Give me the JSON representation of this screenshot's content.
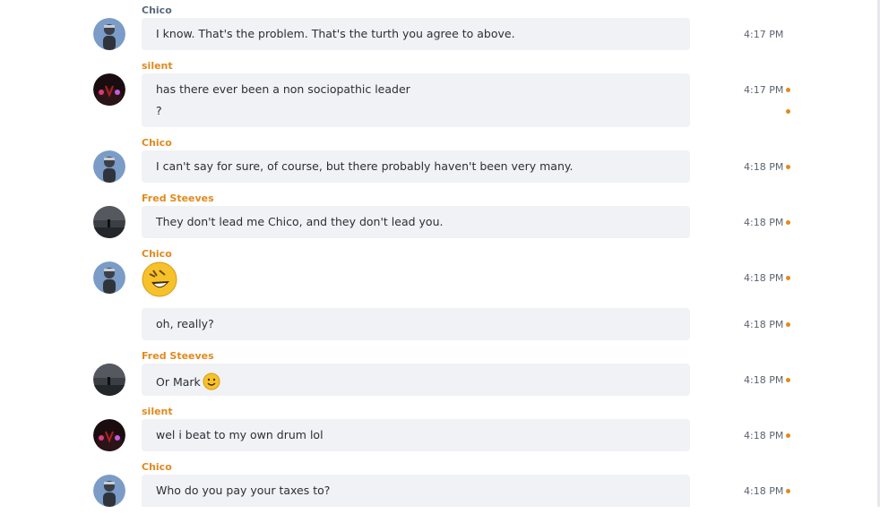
{
  "colors": {
    "author_name": "#e08a1e",
    "bubble": "#f0f2f6",
    "time": "#5b6470",
    "unread_dot": "#e08a1e"
  },
  "messages": [
    {
      "author": "Chico",
      "avatar": "chico",
      "lines": [
        "I know.  That's the problem.  That's the turth you agree to above."
      ],
      "times": [
        "4:17 PM"
      ],
      "unread_dots": [
        false
      ]
    },
    {
      "author": "silent",
      "avatar": "silent",
      "lines": [
        "has there ever been  a non sociopathic leader",
        "?"
      ],
      "times": [
        "4:17 PM",
        ""
      ],
      "unread_dots": [
        true,
        true
      ]
    },
    {
      "author": "Chico",
      "avatar": "chico",
      "lines": [
        "I can't say for sure, of course, but there probably haven't been very many."
      ],
      "times": [
        "4:18 PM"
      ],
      "unread_dots": [
        true
      ]
    },
    {
      "author": "Fred Steeves",
      "avatar": "fred",
      "lines": [
        "They don't lead me Chico, and they don't lead you."
      ],
      "times": [
        "4:18 PM"
      ],
      "unread_dots": [
        true
      ]
    },
    {
      "author": "Chico",
      "avatar": "chico",
      "emoji": "laughing-emoji",
      "lines": [],
      "times": [
        "4:18 PM"
      ],
      "unread_dots": [
        true
      ]
    },
    {
      "author": "",
      "avatar": "",
      "lines": [
        "oh, really?"
      ],
      "times": [
        "4:18 PM"
      ],
      "unread_dots": [
        true
      ]
    },
    {
      "author": "Fred Steeves",
      "avatar": "fred",
      "lines": [
        "Or Mark"
      ],
      "inline_emoji": "smile-emoji",
      "times": [
        "4:18 PM"
      ],
      "unread_dots": [
        true
      ]
    },
    {
      "author": "silent",
      "avatar": "silent",
      "lines": [
        "wel i beat to my own drum lol"
      ],
      "times": [
        "4:18 PM"
      ],
      "unread_dots": [
        true
      ]
    },
    {
      "author": "Chico",
      "avatar": "chico",
      "lines": [
        "Who do you pay your taxes to?"
      ],
      "times": [
        "4:18 PM"
      ],
      "unread_dots": [
        true
      ]
    }
  ]
}
